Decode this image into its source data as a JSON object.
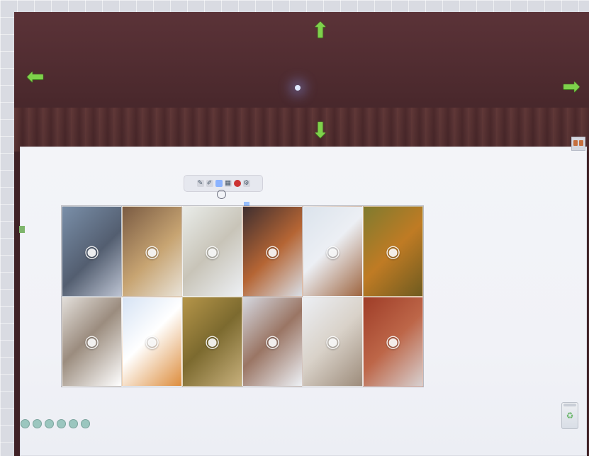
{
  "app": {
    "name": "",
    "mode": ""
  },
  "navigation": {
    "up_icon": "arrow-up-icon",
    "down_icon": "arrow-down-icon",
    "left_icon": "arrow-left-icon",
    "right_icon": "arrow-right-icon"
  },
  "toolbar": {
    "items": [
      {
        "icon": "select-tool-icon"
      },
      {
        "icon": "pen-tool-icon"
      },
      {
        "icon": "highlighter-tool-icon"
      },
      {
        "icon": "shape-tool-icon"
      },
      {
        "icon": "record-tool-icon"
      },
      {
        "icon": "settings-tool-icon"
      }
    ]
  },
  "gallery": {
    "items": [
      {
        "icon": "raccoon-photo-icon"
      },
      {
        "icon": "rabbit-photo-icon"
      },
      {
        "icon": "polar-bears-photo-icon"
      },
      {
        "icon": "fox-photo-icon"
      },
      {
        "icon": "squirrel-photo-icon"
      },
      {
        "icon": "tiger-photo-icon"
      },
      {
        "icon": "panda-photo-icon"
      },
      {
        "icon": "white-tiger-photo-icon"
      },
      {
        "icon": "skunk-photo-icon"
      },
      {
        "icon": "fox-in-snow-photo-icon"
      },
      {
        "icon": "snow-leopard-photo-icon"
      },
      {
        "icon": "wild-cat-photo-icon"
      }
    ]
  },
  "pagination": {
    "count": 6
  },
  "trash": {
    "icon": "trash-icon"
  },
  "colors": {
    "curtain": "#4b292d",
    "board": "#f1f2f7",
    "arrow": "#7ed24b",
    "toolbar": "#e6e8ef",
    "pagination": "#9bc6bf"
  }
}
